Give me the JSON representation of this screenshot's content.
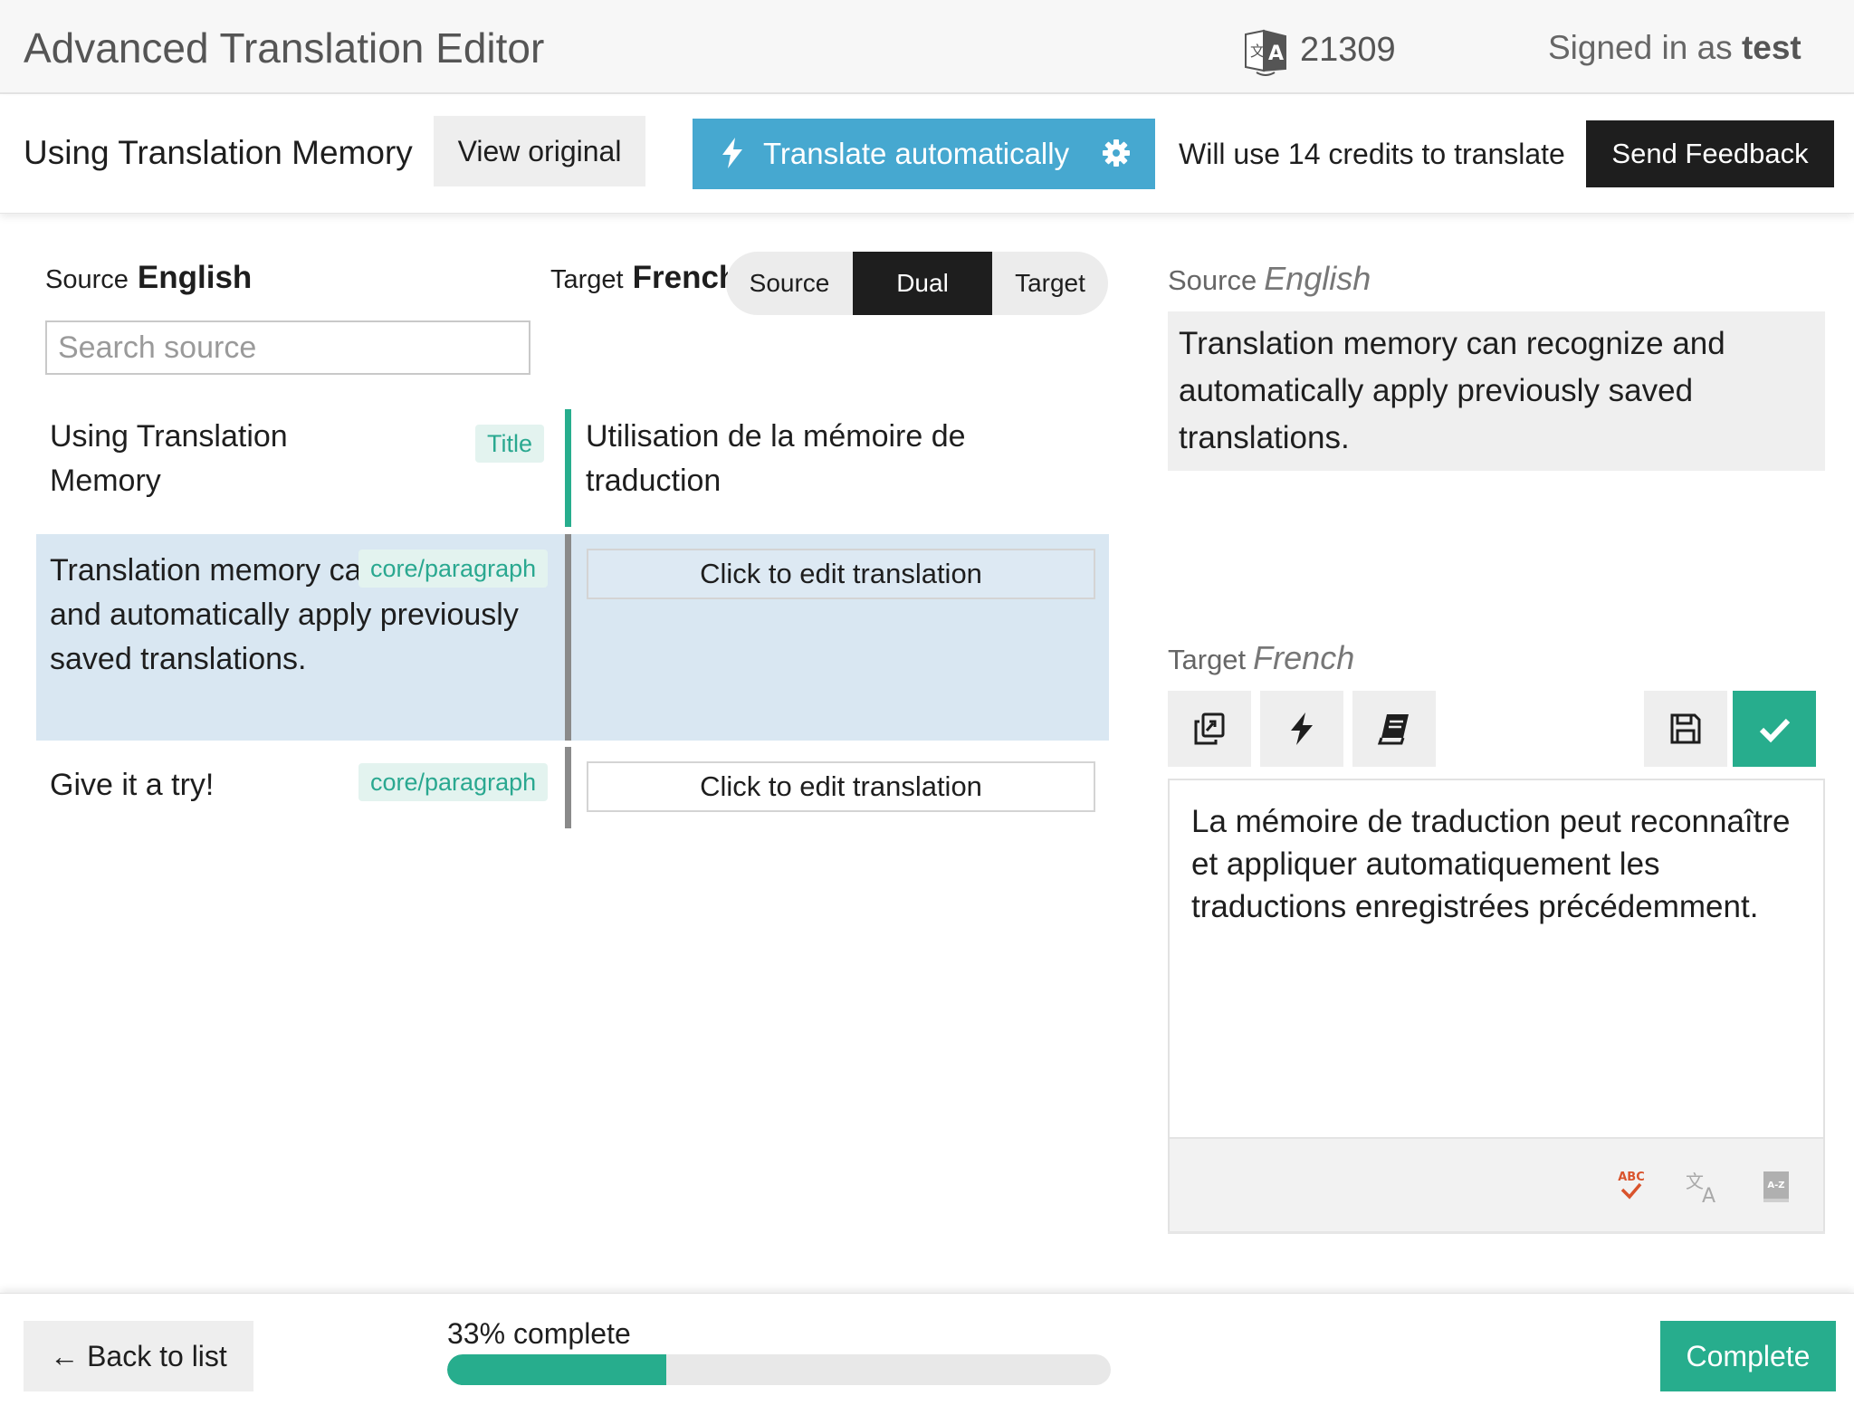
{
  "topbar": {
    "app_title": "Advanced Translation Editor",
    "credits_icon": "translate-icon",
    "credits_count": "21309",
    "signed_in_prefix": "Signed in as",
    "username": "test"
  },
  "toolbar": {
    "doc_title": "Using Translation Memory",
    "view_original_label": "View original",
    "translate_auto_label": "Translate automatically",
    "credits_note": "Will use 14 credits to translate",
    "send_feedback_label": "Send Feedback"
  },
  "left_panel": {
    "source_label": "Source",
    "source_lang": "English",
    "target_label": "Target",
    "target_lang": "French",
    "view_toggle": [
      "Source",
      "Dual",
      "Target"
    ],
    "view_selected": "Dual",
    "search_placeholder": "Search source",
    "rows": [
      {
        "source": "Using Translation Memory",
        "tag": "Title",
        "target": "Utilisation de la mémoire de traduction",
        "state": "translated"
      },
      {
        "source": "Translation memory can recognize and automatically apply previously saved translations.",
        "tag": "core/paragraph",
        "target_button": "Click to edit translation",
        "state": "selected"
      },
      {
        "source": "Give it a try!",
        "tag": "core/paragraph",
        "target_button": "Click to edit translation",
        "state": "untranslated"
      }
    ]
  },
  "right_panel": {
    "source_label": "Source",
    "source_lang": "English",
    "source_text": "Translation memory can recognize and automatically apply previously saved translations.",
    "target_label": "Target",
    "target_lang": "French",
    "tools": [
      "copy-icon",
      "bolt-icon",
      "book-icon",
      "save-icon",
      "check-icon"
    ],
    "editor_text": "La mémoire de traduction peut reconnaître et appliquer automatiquement les traductions enregistrées précédemment.",
    "footer_icons": [
      "spellcheck-icon",
      "translate-icon",
      "dictionary-icon"
    ]
  },
  "bottombar": {
    "back_label": "← Back to list",
    "progress_label": "33% complete",
    "progress_percent": 33,
    "complete_label": "Complete"
  },
  "colors": {
    "accent_blue": "#46a8d0",
    "accent_green": "#27ad8d",
    "selected_row": "#d9e7f2",
    "dark": "#1e1e1e"
  }
}
